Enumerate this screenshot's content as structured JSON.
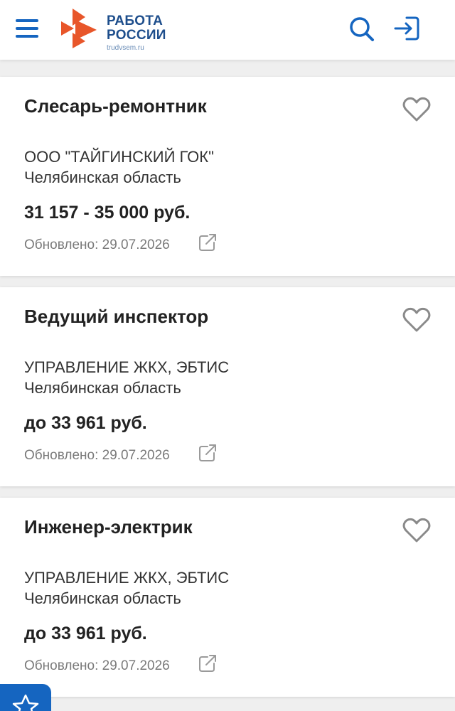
{
  "header": {
    "logo_line1": "РАБОТА",
    "logo_line2": "РОССИИ",
    "logo_url": "trudvsem.ru",
    "menu_icon": "hamburger-icon",
    "search_icon": "search-icon",
    "login_icon": "login-icon",
    "brand_colors": {
      "blue": "#1565c0",
      "orange": "#e8562a",
      "dark_blue": "#1e4e8c"
    }
  },
  "vacancies": [
    {
      "title": "Слесарь-ремонтник",
      "company": "ООО \"ТАЙГИНСКИЙ ГОК\"",
      "region": "Челябинская область",
      "salary": "31 157 - 35 000 руб.",
      "updated": "Обновлено: 29.07.2026"
    },
    {
      "title": "Ведущий инспектор",
      "company": "УПРАВЛЕНИЕ ЖКХ, ЭБТИС",
      "region": "Челябинская область",
      "salary": "до 33 961 руб.",
      "updated": "Обновлено: 29.07.2026"
    },
    {
      "title": "Инженер-электрик",
      "company": "УПРАВЛЕНИЕ ЖКХ, ЭБТИС",
      "region": "Челябинская область",
      "salary": "до 33 961 руб.",
      "updated": "Обновлено: 29.07.2026"
    }
  ],
  "card_icons": {
    "favorite": "heart-icon",
    "share": "external-link-icon"
  },
  "fab_icon": "star-icon"
}
